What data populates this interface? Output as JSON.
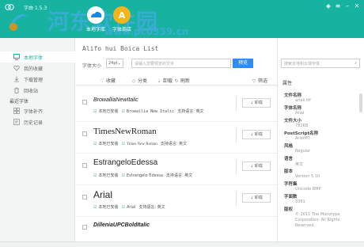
{
  "app": {
    "title": "字由 1.5.3"
  },
  "watermark": {
    "text": "河东软件园",
    "url": "www.pc0359.cn"
  },
  "top_tabs": [
    {
      "label": "本地字库",
      "icon": "cloud-icon",
      "color": "#1a8ad8"
    },
    {
      "label": "字体商店",
      "icon": "letter-a-icon",
      "color": "#f5b51a"
    }
  ],
  "sidebar": {
    "items": [
      {
        "label": "本地字体",
        "icon": "monitor-icon"
      },
      {
        "label": "我的收藏",
        "icon": "heart-icon"
      },
      {
        "label": "下载管理",
        "icon": "download-icon"
      },
      {
        "label": "回收站",
        "icon": "trash-icon"
      }
    ],
    "section_title": "最近字体",
    "sub_items": [
      {
        "label": "字体补齐",
        "icon": "grid-icon"
      },
      {
        "label": "历史记录",
        "icon": "history-icon"
      }
    ]
  },
  "main": {
    "list_title": "Alifo hui Boica List",
    "size_label": "字体大小",
    "size_value": "24pt",
    "preview_placeholder": "请输入您要预览的文字",
    "preview_button": "预览",
    "toolbar": [
      {
        "label": "收藏",
        "icon": "heart-outline-icon"
      },
      {
        "label": "分类",
        "icon": "folder-icon"
      },
      {
        "label": "卸载",
        "icon": "download-icon"
      },
      {
        "label": "刷新",
        "icon": "refresh-icon"
      },
      {
        "label": "筛选",
        "icon": "filter-icon"
      }
    ],
    "fonts": [
      {
        "name": "BrowalliaNewItalic",
        "status": "本地已安装",
        "sample": "Browallia New Italic",
        "lang": "支持语言: 英文",
        "action": "卸载"
      },
      {
        "name": "TimesNewRoman",
        "status": "本地已安装",
        "sample": "Times New Roman",
        "lang": "支持语言: 英文",
        "action": "卸载"
      },
      {
        "name": "EstrangeloEdessa",
        "status": "本地已安装",
        "sample": "Estrangelo Edessa",
        "lang": "支持语言: 英文",
        "action": "卸载"
      },
      {
        "name": "Arial",
        "status": "本地已安装",
        "sample": "Arial",
        "lang": "支持语言: 英文",
        "action": "卸载"
      },
      {
        "name": "DilleniaUPCBoldItalic",
        "status": "",
        "sample": "",
        "lang": "",
        "action": ""
      }
    ]
  },
  "right_panel": {
    "search_placeholder": "搜索本地和云端字体",
    "title": "属性",
    "properties": [
      {
        "key": "文件名称",
        "value": "ariali.ttf"
      },
      {
        "key": "字体名称",
        "value": "Arial"
      },
      {
        "key": "文件大小",
        "value": "781KB"
      },
      {
        "key": "PostScript名称",
        "value": "ArialMT"
      },
      {
        "key": "风格",
        "value": "Regular"
      },
      {
        "key": "语言",
        "value": "英文"
      },
      {
        "key": "版本",
        "value": "Version 5.10"
      },
      {
        "key": "字符集",
        "value": "Unicode BMP"
      },
      {
        "key": "字面数",
        "value": "3361"
      },
      {
        "key": "版权",
        "value": "© 2011 The Monotype Corporation. All Rights Reserved."
      }
    ]
  },
  "colors": {
    "accent": "#17b3a0",
    "primary_button": "#2f8cf0",
    "installed": "#3cb371"
  }
}
